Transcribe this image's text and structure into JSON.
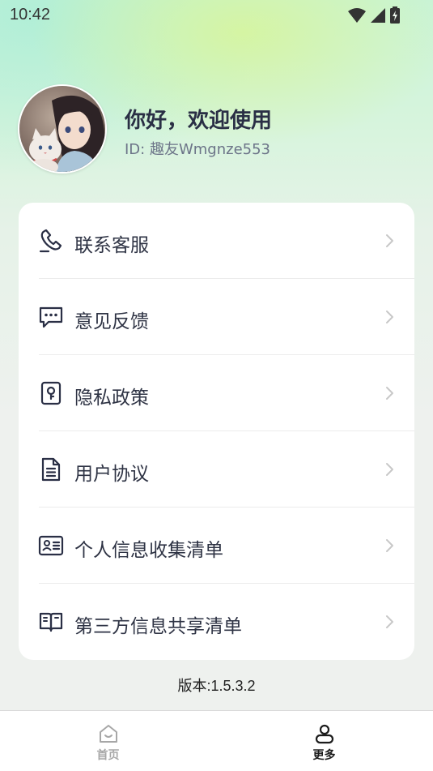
{
  "status_bar": {
    "time": "10:42",
    "icons": [
      "wifi-icon",
      "cellular-signal-icon",
      "battery-charging-icon"
    ]
  },
  "profile": {
    "greeting": "你好，欢迎使用",
    "user_id": "ID: 趣友Wmgnze553",
    "avatar": "avatar-image"
  },
  "menu": {
    "items": [
      {
        "label": "联系客服",
        "icon": "phone-icon"
      },
      {
        "label": "意见反馈",
        "icon": "feedback-chat-icon"
      },
      {
        "label": "隐私政策",
        "icon": "privacy-lock-icon"
      },
      {
        "label": "用户协议",
        "icon": "document-icon"
      },
      {
        "label": "个人信息收集清单",
        "icon": "id-card-icon"
      },
      {
        "label": "第三方信息共享清单",
        "icon": "open-book-icon"
      }
    ]
  },
  "version": "版本:1.5.3.2",
  "tabbar": {
    "tabs": [
      {
        "label": "首页",
        "icon": "home-icon",
        "active": false
      },
      {
        "label": "更多",
        "icon": "profile-icon",
        "active": true
      }
    ]
  },
  "colors": {
    "accent_text": "#2a2f45",
    "muted_text": "#6c7488",
    "inactive_tab": "#a7a7a7",
    "active_tab": "#1c1c1c",
    "gradient_top": "#c8f3d8"
  }
}
